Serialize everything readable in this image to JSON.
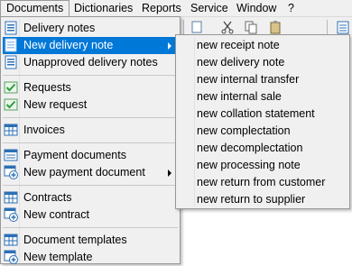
{
  "menubar": {
    "items": [
      {
        "label": "Documents"
      },
      {
        "label": "Dictionaries"
      },
      {
        "label": "Reports"
      },
      {
        "label": "Service"
      },
      {
        "label": "Window"
      },
      {
        "label": "?"
      }
    ]
  },
  "documents_menu": {
    "items": [
      {
        "label": "Delivery notes",
        "icon": "document-list-icon"
      },
      {
        "label": "New delivery note",
        "icon": "document-list-icon",
        "submenu": true,
        "highlighted": true
      },
      {
        "label": "Unapproved delivery notes",
        "icon": "document-list-icon"
      },
      {
        "label": "Requests",
        "icon": "checkmark-icon"
      },
      {
        "label": "New request",
        "icon": "checkmark-icon"
      },
      {
        "label": "Invoices",
        "icon": "table-icon"
      },
      {
        "label": "Payment documents",
        "icon": "payment-list-icon"
      },
      {
        "label": "New payment document",
        "icon": "payment-add-icon",
        "submenu": true
      },
      {
        "label": "Contracts",
        "icon": "table-icon"
      },
      {
        "label": "New contract",
        "icon": "table-add-icon"
      },
      {
        "label": "Document templates",
        "icon": "table-icon"
      },
      {
        "label": "New template",
        "icon": "table-add-icon"
      }
    ]
  },
  "new_delivery_note_submenu": {
    "items": [
      {
        "label": "new receipt note"
      },
      {
        "label": "new delivery note"
      },
      {
        "label": "new internal transfer"
      },
      {
        "label": "new internal sale"
      },
      {
        "label": "new collation statement"
      },
      {
        "label": "new complectation"
      },
      {
        "label": "new decomplectation"
      },
      {
        "label": "new processing note"
      },
      {
        "label": "new return from customer"
      },
      {
        "label": "new return to supplier"
      }
    ]
  },
  "colors": {
    "highlight": "#0078d7",
    "menu_bg": "#f0f0f0",
    "check_green": "#2e9e3e",
    "doc_blue": "#2c6fb5"
  }
}
